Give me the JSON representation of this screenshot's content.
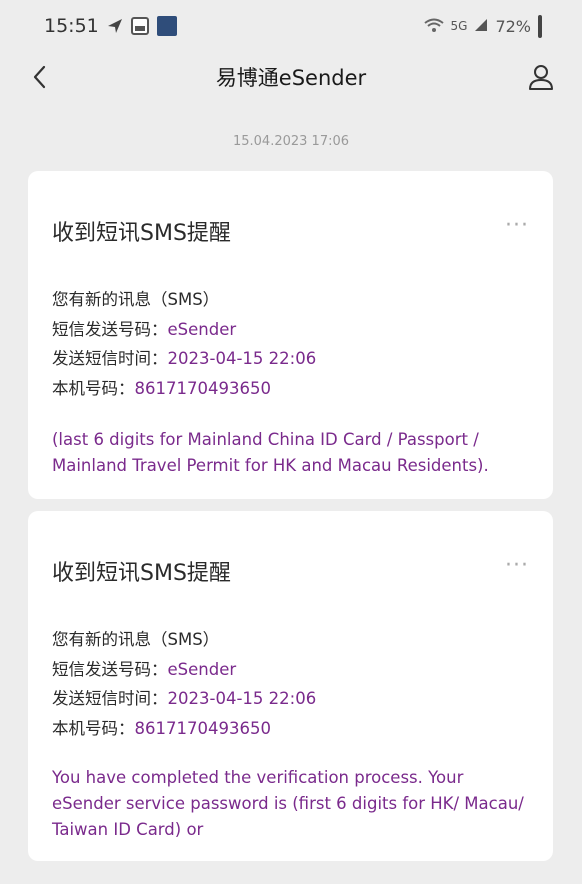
{
  "status_bar": {
    "time": "15:51",
    "battery": "72%",
    "signal_text": "5G"
  },
  "nav": {
    "title": "易博通eSender"
  },
  "timestamp": "15.04.2023 17:06",
  "cards": [
    {
      "title": "收到短讯SMS提醒",
      "more": "···",
      "lines": [
        {
          "label": "您有新的讯息（SMS）",
          "value": ""
        },
        {
          "label": "短信发送号码：",
          "value": "eSender"
        },
        {
          "label": "发送短信时间：",
          "value": "2023-04-15 22:06"
        },
        {
          "label": "本机号码：",
          "value": "8617170493650"
        }
      ],
      "note": "(last 6 digits for Mainland China ID Card / Passport / Mainland Travel Permit for HK and Macau Residents)."
    },
    {
      "title": "收到短讯SMS提醒",
      "more": "···",
      "lines": [
        {
          "label": "您有新的讯息（SMS）",
          "value": ""
        },
        {
          "label": "短信发送号码：",
          "value": "eSender"
        },
        {
          "label": "发送短信时间：",
          "value": "2023-04-15 22:06"
        },
        {
          "label": "本机号码：",
          "value": "8617170493650"
        }
      ],
      "note": "You have completed the verification process. Your eSender service password is (first 6 digits for HK/ Macau/ Taiwan ID Card) or"
    }
  ],
  "icons": {
    "back": "chevron-left-icon",
    "profile": "person-icon",
    "more": "more-dots-icon"
  },
  "colors": {
    "background": "#ededed",
    "card": "#ffffff",
    "accent_value": "#7a2a8c"
  }
}
